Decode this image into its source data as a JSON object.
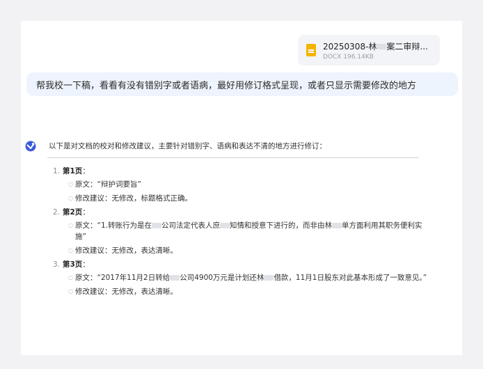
{
  "file": {
    "name": "20250308-林",
    "name_suffix": "案二审辩...",
    "meta": "DOCX 196.14KB"
  },
  "user_message": "帮我校一下稿，看看有没有错别字或者语病，最好用修订格式呈现，或者只显示需要修改的地方",
  "assistant": {
    "intro": "以下是对文档的校对和修改建议，主要针对错别字、语病和表达不清的地方进行修订：",
    "items": [
      {
        "num": "1.",
        "title": "第1页",
        "colon": "：",
        "bullets": [
          {
            "parts": [
              "原文：“辩护词要旨”"
            ]
          },
          {
            "parts": [
              "修改建议：无修改，标题格式正确。"
            ]
          }
        ]
      },
      {
        "num": "2.",
        "title": "第2页",
        "colon": "：",
        "bullets": [
          {
            "parts": [
              "原文：“1.转账行为是在",
              "公司法定代表人庶",
              "知情和授意下进行的，而非由林",
              "单方面利用其职务便利实施”"
            ]
          },
          {
            "parts": [
              "修改建议：无修改，表达清晰。"
            ]
          }
        ]
      },
      {
        "num": "3.",
        "title": "第3页",
        "colon": "：",
        "bullets": [
          {
            "parts": [
              "原文：“2017年11月2日转给",
              "公司4900万元是计划还林",
              "借款，11月1日股东对此基本形成了一致意见。”"
            ]
          },
          {
            "parts": [
              "修改建议：无修改，表达清晰。"
            ]
          }
        ]
      }
    ]
  }
}
